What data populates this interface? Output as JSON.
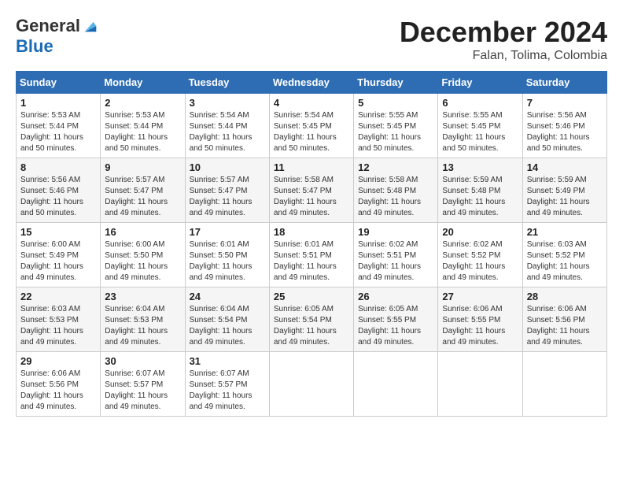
{
  "logo": {
    "general": "General",
    "blue": "Blue"
  },
  "title": {
    "month_year": "December 2024",
    "location": "Falan, Tolima, Colombia"
  },
  "days_of_week": [
    "Sunday",
    "Monday",
    "Tuesday",
    "Wednesday",
    "Thursday",
    "Friday",
    "Saturday"
  ],
  "weeks": [
    [
      {
        "day": "1",
        "sunrise": "5:53 AM",
        "sunset": "5:44 PM",
        "daylight": "11 hours and 50 minutes."
      },
      {
        "day": "2",
        "sunrise": "5:53 AM",
        "sunset": "5:44 PM",
        "daylight": "11 hours and 50 minutes."
      },
      {
        "day": "3",
        "sunrise": "5:54 AM",
        "sunset": "5:44 PM",
        "daylight": "11 hours and 50 minutes."
      },
      {
        "day": "4",
        "sunrise": "5:54 AM",
        "sunset": "5:45 PM",
        "daylight": "11 hours and 50 minutes."
      },
      {
        "day": "5",
        "sunrise": "5:55 AM",
        "sunset": "5:45 PM",
        "daylight": "11 hours and 50 minutes."
      },
      {
        "day": "6",
        "sunrise": "5:55 AM",
        "sunset": "5:45 PM",
        "daylight": "11 hours and 50 minutes."
      },
      {
        "day": "7",
        "sunrise": "5:56 AM",
        "sunset": "5:46 PM",
        "daylight": "11 hours and 50 minutes."
      }
    ],
    [
      {
        "day": "8",
        "sunrise": "5:56 AM",
        "sunset": "5:46 PM",
        "daylight": "11 hours and 50 minutes."
      },
      {
        "day": "9",
        "sunrise": "5:57 AM",
        "sunset": "5:47 PM",
        "daylight": "11 hours and 49 minutes."
      },
      {
        "day": "10",
        "sunrise": "5:57 AM",
        "sunset": "5:47 PM",
        "daylight": "11 hours and 49 minutes."
      },
      {
        "day": "11",
        "sunrise": "5:58 AM",
        "sunset": "5:47 PM",
        "daylight": "11 hours and 49 minutes."
      },
      {
        "day": "12",
        "sunrise": "5:58 AM",
        "sunset": "5:48 PM",
        "daylight": "11 hours and 49 minutes."
      },
      {
        "day": "13",
        "sunrise": "5:59 AM",
        "sunset": "5:48 PM",
        "daylight": "11 hours and 49 minutes."
      },
      {
        "day": "14",
        "sunrise": "5:59 AM",
        "sunset": "5:49 PM",
        "daylight": "11 hours and 49 minutes."
      }
    ],
    [
      {
        "day": "15",
        "sunrise": "6:00 AM",
        "sunset": "5:49 PM",
        "daylight": "11 hours and 49 minutes."
      },
      {
        "day": "16",
        "sunrise": "6:00 AM",
        "sunset": "5:50 PM",
        "daylight": "11 hours and 49 minutes."
      },
      {
        "day": "17",
        "sunrise": "6:01 AM",
        "sunset": "5:50 PM",
        "daylight": "11 hours and 49 minutes."
      },
      {
        "day": "18",
        "sunrise": "6:01 AM",
        "sunset": "5:51 PM",
        "daylight": "11 hours and 49 minutes."
      },
      {
        "day": "19",
        "sunrise": "6:02 AM",
        "sunset": "5:51 PM",
        "daylight": "11 hours and 49 minutes."
      },
      {
        "day": "20",
        "sunrise": "6:02 AM",
        "sunset": "5:52 PM",
        "daylight": "11 hours and 49 minutes."
      },
      {
        "day": "21",
        "sunrise": "6:03 AM",
        "sunset": "5:52 PM",
        "daylight": "11 hours and 49 minutes."
      }
    ],
    [
      {
        "day": "22",
        "sunrise": "6:03 AM",
        "sunset": "5:53 PM",
        "daylight": "11 hours and 49 minutes."
      },
      {
        "day": "23",
        "sunrise": "6:04 AM",
        "sunset": "5:53 PM",
        "daylight": "11 hours and 49 minutes."
      },
      {
        "day": "24",
        "sunrise": "6:04 AM",
        "sunset": "5:54 PM",
        "daylight": "11 hours and 49 minutes."
      },
      {
        "day": "25",
        "sunrise": "6:05 AM",
        "sunset": "5:54 PM",
        "daylight": "11 hours and 49 minutes."
      },
      {
        "day": "26",
        "sunrise": "6:05 AM",
        "sunset": "5:55 PM",
        "daylight": "11 hours and 49 minutes."
      },
      {
        "day": "27",
        "sunrise": "6:06 AM",
        "sunset": "5:55 PM",
        "daylight": "11 hours and 49 minutes."
      },
      {
        "day": "28",
        "sunrise": "6:06 AM",
        "sunset": "5:56 PM",
        "daylight": "11 hours and 49 minutes."
      }
    ],
    [
      {
        "day": "29",
        "sunrise": "6:06 AM",
        "sunset": "5:56 PM",
        "daylight": "11 hours and 49 minutes."
      },
      {
        "day": "30",
        "sunrise": "6:07 AM",
        "sunset": "5:57 PM",
        "daylight": "11 hours and 49 minutes."
      },
      {
        "day": "31",
        "sunrise": "6:07 AM",
        "sunset": "5:57 PM",
        "daylight": "11 hours and 49 minutes."
      },
      null,
      null,
      null,
      null
    ]
  ],
  "labels": {
    "sunrise": "Sunrise: ",
    "sunset": "Sunset: ",
    "daylight": "Daylight: "
  }
}
